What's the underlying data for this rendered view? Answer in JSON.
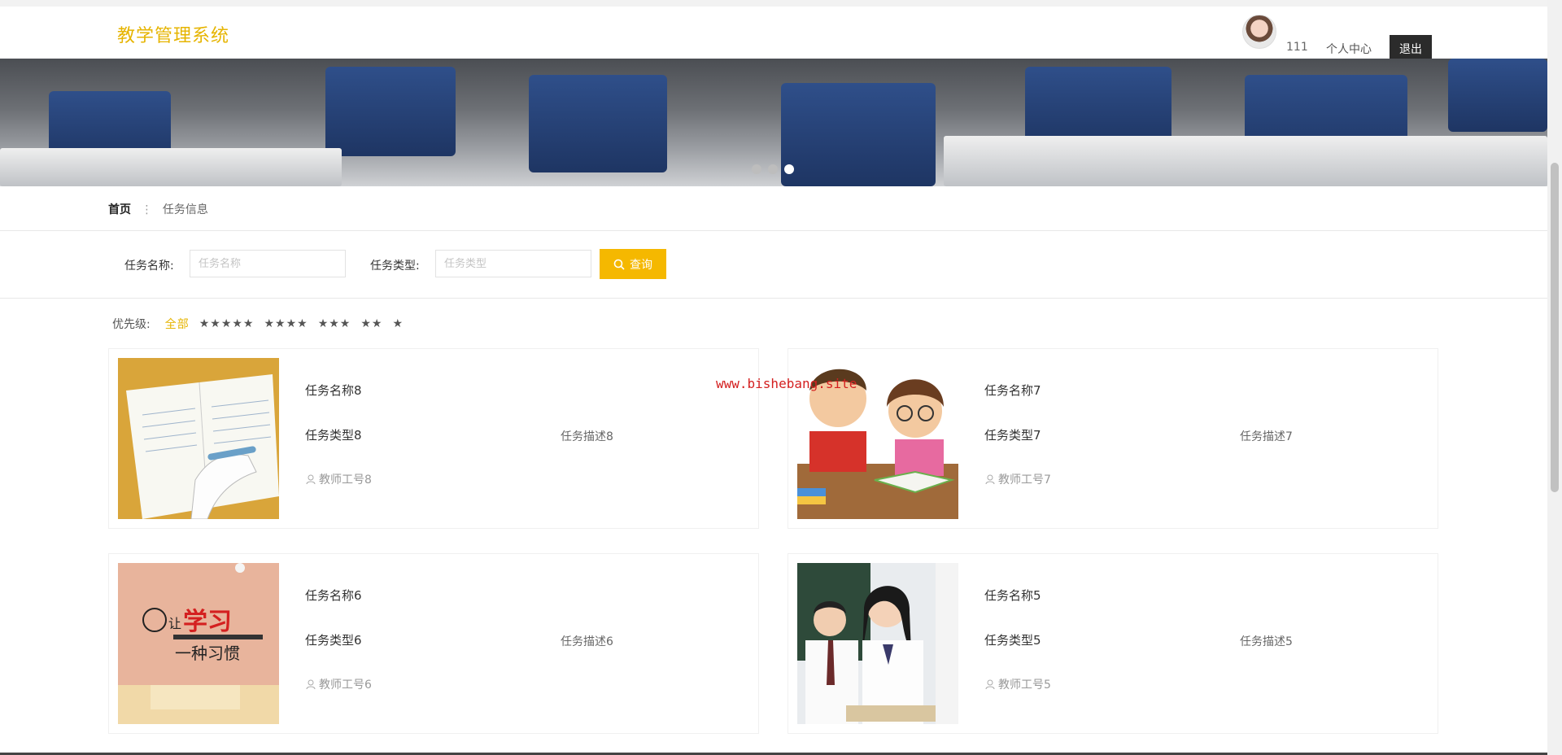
{
  "header": {
    "brand": "教学管理系统",
    "username": "111",
    "personal_center": "个人中心",
    "logout": "退出"
  },
  "banner": {
    "slide_count": 3,
    "active_slide": 3
  },
  "breadcrumb": {
    "home": "首页",
    "separator": "⋮",
    "current": "任务信息"
  },
  "search": {
    "task_name_label": "任务名称:",
    "task_name_placeholder": "任务名称",
    "task_type_label": "任务类型:",
    "task_type_placeholder": "任务类型",
    "query_button": "查询"
  },
  "priority": {
    "label": "优先级:",
    "options": [
      "全部",
      "★★★★★",
      "★★★★",
      "★★★",
      "★★",
      "★"
    ],
    "selected": "全部"
  },
  "cards": [
    {
      "name": "任务名称8",
      "type": "任务类型8",
      "desc": "任务描述8",
      "teacher": "教师工号8",
      "image": "notebook-image"
    },
    {
      "name": "任务名称7",
      "type": "任务类型7",
      "desc": "任务描述7",
      "teacher": "教师工号7",
      "image": "cartoon-kids-reading-image"
    },
    {
      "name": "任务名称6",
      "type": "任务类型6",
      "desc": "任务描述6",
      "teacher": "教师工号6",
      "image": "study-habit-wall-image"
    },
    {
      "name": "任务名称5",
      "type": "任务类型5",
      "desc": "任务描述5",
      "teacher": "教师工号5",
      "image": "students-classroom-image"
    }
  ],
  "watermark": "www.bishebang.site",
  "colors": {
    "accent": "#f5b800",
    "brand": "#e6b400",
    "dark_button": "#2b2b2b"
  },
  "icons": {
    "search": "search-icon",
    "user": "user-icon"
  }
}
